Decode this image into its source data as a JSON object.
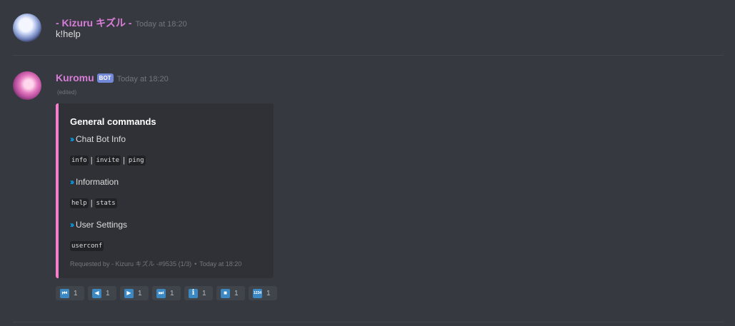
{
  "messages": [
    {
      "author": "- Kizuru キズル -",
      "author_color": "#d97dd9",
      "timestamp": "Today at 18:20",
      "content": "k!help"
    },
    {
      "author": "Kuromu",
      "author_color": "#d97dd9",
      "bot_tag": "BOT",
      "timestamp": "Today at 18:20",
      "edited": "(edited)",
      "embed": {
        "border_color": "#f47fcd",
        "title": "General commands",
        "fields": [
          {
            "name": "Chat Bot Info",
            "chevron": "››",
            "codes": [
              "info",
              "invite",
              "ping"
            ]
          },
          {
            "name": "Information",
            "chevron": "››",
            "codes": [
              "help",
              "stats"
            ]
          },
          {
            "name": "User Settings",
            "chevron": "››",
            "codes": [
              "userconf"
            ]
          }
        ],
        "separator": "|",
        "footer": {
          "text": "Requested by - Kizuru キズル -#9535 (1/3)",
          "dot": "•",
          "timestamp": "Today at 18:20"
        }
      },
      "reactions": [
        {
          "icon": "first-page-icon",
          "glyph": "⏮",
          "count": "1"
        },
        {
          "icon": "previous-page-icon",
          "glyph": "◀",
          "count": "1"
        },
        {
          "icon": "next-page-icon",
          "glyph": "▶",
          "count": "1"
        },
        {
          "icon": "last-page-icon",
          "glyph": "⏭",
          "count": "1"
        },
        {
          "icon": "info-icon",
          "glyph": "i",
          "count": "1"
        },
        {
          "icon": "stop-icon",
          "glyph": "■",
          "count": "1"
        },
        {
          "icon": "numbers-icon",
          "glyph": "1234",
          "count": "1"
        }
      ]
    }
  ]
}
